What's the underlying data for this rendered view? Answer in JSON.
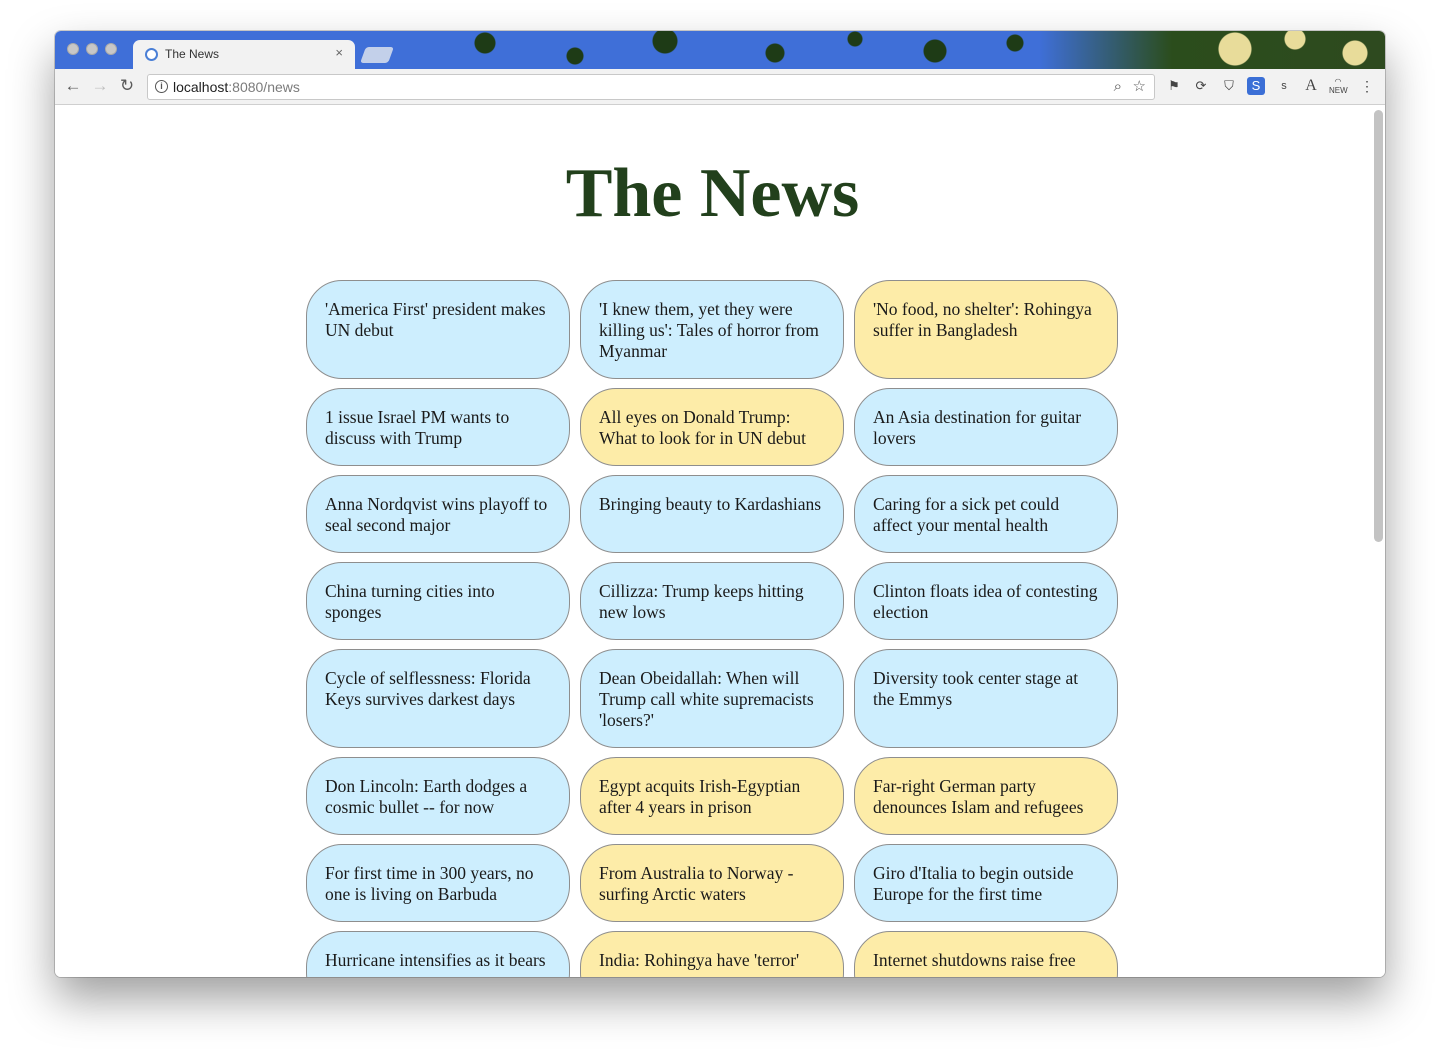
{
  "browser": {
    "tab_title": "The News",
    "tab_close": "×",
    "url_host": "localhost",
    "url_path": ":8080/news"
  },
  "page": {
    "title": "The News"
  },
  "colors": {
    "card_blue": "#cdeefe",
    "card_yellow": "#fdeca8",
    "title_green": "#22401c"
  },
  "articles": [
    {
      "headline": "'America First' president makes UN debut",
      "highlight": false
    },
    {
      "headline": "'I knew them, yet they were killing us': Tales of horror from Myanmar",
      "highlight": false
    },
    {
      "headline": "'No food, no shelter': Rohingya suffer in Bangladesh",
      "highlight": true
    },
    {
      "headline": "1 issue Israel PM wants to discuss with Trump",
      "highlight": false
    },
    {
      "headline": "All eyes on Donald Trump: What to look for in UN debut",
      "highlight": true
    },
    {
      "headline": "An Asia destination for guitar lovers",
      "highlight": false
    },
    {
      "headline": "Anna Nordqvist wins playoff to seal second major",
      "highlight": false
    },
    {
      "headline": "Bringing beauty to Kardashians",
      "highlight": false
    },
    {
      "headline": "Caring for a sick pet could affect your mental health",
      "highlight": false
    },
    {
      "headline": "China turning cities into sponges",
      "highlight": false
    },
    {
      "headline": "Cillizza: Trump keeps hitting new lows",
      "highlight": false
    },
    {
      "headline": "Clinton floats idea of contesting election",
      "highlight": false
    },
    {
      "headline": "Cycle of selflessness: Florida Keys survives darkest days",
      "highlight": false
    },
    {
      "headline": "Dean Obeidallah: When will Trump call white supremacists 'losers?'",
      "highlight": false
    },
    {
      "headline": "Diversity took center stage at the Emmys",
      "highlight": false
    },
    {
      "headline": "Don Lincoln: Earth dodges a cosmic bullet -- for now",
      "highlight": false
    },
    {
      "headline": "Egypt acquits Irish-Egyptian after 4 years in prison",
      "highlight": true
    },
    {
      "headline": "Far-right German party denounces Islam and refugees",
      "highlight": true
    },
    {
      "headline": "For first time in 300 years, no one is living on Barbuda",
      "highlight": false
    },
    {
      "headline": "From Australia to Norway - surfing Arctic waters",
      "highlight": true
    },
    {
      "headline": "Giro d'Italia to begin outside Europe for the first time",
      "highlight": false
    },
    {
      "headline": "Hurricane intensifies as it bears",
      "highlight": false
    },
    {
      "headline": "India: Rohingya have 'terror'",
      "highlight": true
    },
    {
      "headline": "Internet shutdowns raise free",
      "highlight": true
    }
  ]
}
